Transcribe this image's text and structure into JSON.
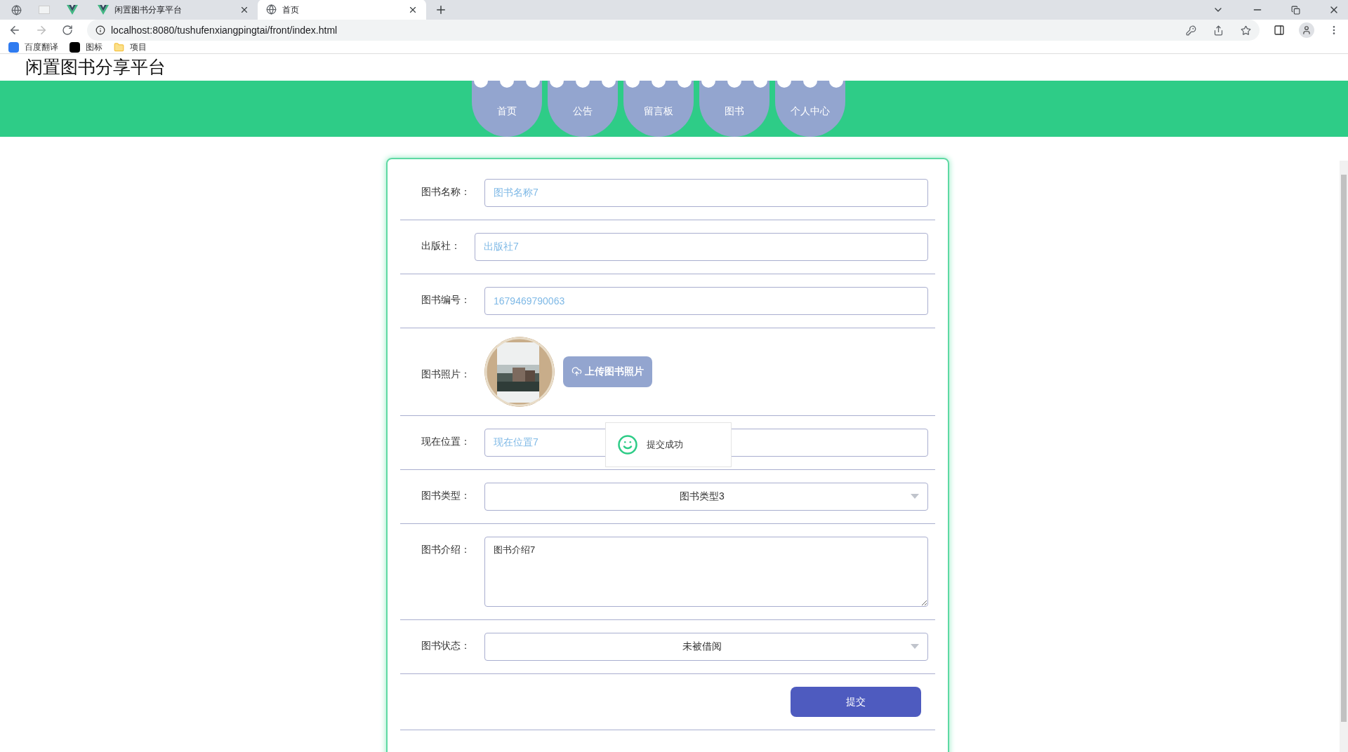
{
  "browser": {
    "tabs": [
      {
        "title": "闲置图书分享平台",
        "selected": false
      },
      {
        "title": "首页",
        "selected": true
      }
    ],
    "url": "localhost:8080/tushufenxiangpingtai/front/index.html",
    "bookmarks": [
      "百度翻译",
      "图标",
      "项目"
    ]
  },
  "site": {
    "title": "闲置图书分享平台"
  },
  "nav": [
    {
      "label": "首页"
    },
    {
      "label": "公告"
    },
    {
      "label": "留言板"
    },
    {
      "label": "图书"
    },
    {
      "label": "个人中心"
    }
  ],
  "form": {
    "fields": [
      {
        "kind": "input",
        "label": "图书名称：",
        "value": "图书名称7"
      },
      {
        "kind": "input",
        "label": "出版社：",
        "value": "出版社7"
      },
      {
        "kind": "input",
        "label": "图书编号：",
        "value": "1679469790063"
      },
      {
        "label": "图书照片：",
        "button": "上传图书照片"
      },
      {
        "kind": "input",
        "label": "现在位置：",
        "value": "现在位置7"
      },
      {
        "kind": "select",
        "label": "图书类型：",
        "value": "图书类型3"
      },
      {
        "kind": "textarea",
        "label": "图书介绍：",
        "value": "图书介绍7"
      },
      {
        "kind": "select",
        "label": "图书状态：",
        "value": "未被借阅"
      }
    ],
    "submit": "提交"
  },
  "toast": {
    "message": "提交成功"
  }
}
